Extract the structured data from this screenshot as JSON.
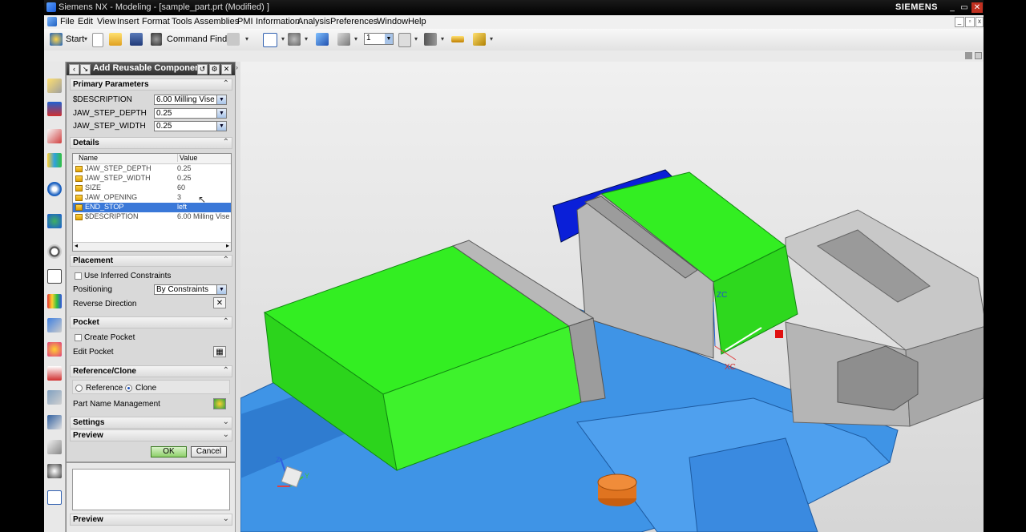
{
  "window": {
    "title": "Siemens NX - Modeling - [sample_part.prt (Modified) ]",
    "brand": "SIEMENS",
    "controls": [
      "_",
      "▭",
      "✕"
    ]
  },
  "menubar": {
    "items": [
      "File",
      "Edit",
      "View",
      "Insert",
      "Format",
      "Tools",
      "Assemblies",
      "PMI",
      "Information",
      "Analysis",
      "Preferences",
      "Window",
      "Help"
    ]
  },
  "toolbar": {
    "start_label": "Start",
    "command_finder_label": "Command Finder",
    "layer_value": "1"
  },
  "dialog": {
    "title": "Add Reusable Component",
    "sections": {
      "primary": "Primary Parameters",
      "details": "Details",
      "placement": "Placement",
      "pocket": "Pocket",
      "refclone": "Reference/Clone",
      "settings": "Settings",
      "preview": "Preview",
      "preview_bottom": "Preview"
    },
    "primary_params": [
      {
        "label": "$DESCRIPTION",
        "value": "6.00 Milling Vise"
      },
      {
        "label": "JAW_STEP_DEPTH",
        "value": "0.25"
      },
      {
        "label": "JAW_STEP_WIDTH",
        "value": "0.25"
      }
    ],
    "details_headers": {
      "name": "Name",
      "value": "Value"
    },
    "details_rows": [
      {
        "name": "JAW_STEP_DEPTH",
        "value": "0.25"
      },
      {
        "name": "JAW_STEP_WIDTH",
        "value": "0.25"
      },
      {
        "name": "SIZE",
        "value": "60"
      },
      {
        "name": "JAW_OPENING",
        "value": "3"
      },
      {
        "name": "END_STOP",
        "value": "left",
        "selected": true
      },
      {
        "name": "$DESCRIPTION",
        "value": "6.00 Milling Vise"
      }
    ],
    "placement": {
      "use_inferred": "Use Inferred Constraints",
      "positioning_label": "Positioning",
      "positioning_value": "By Constraints",
      "reverse_direction": "Reverse Direction"
    },
    "pocket": {
      "create_pocket": "Create Pocket",
      "edit_pocket": "Edit Pocket"
    },
    "refclone": {
      "reference": "Reference",
      "clone": "Clone",
      "selected": "Clone",
      "part_name_mgmt": "Part Name Management"
    },
    "ok_label": "OK",
    "cancel_label": "Cancel"
  },
  "viewport": {
    "axis_labels": {
      "zc": "ZC",
      "xc": "XC",
      "triad_z": "Z",
      "triad_y": "Y"
    },
    "colors": {
      "jaw_green": "#33ee22",
      "base_blue": "#3f94e6",
      "end_stop_blue": "#0a1fd8",
      "steel_grey": "#b8b8b8",
      "nut_orange": "#e07420"
    }
  }
}
